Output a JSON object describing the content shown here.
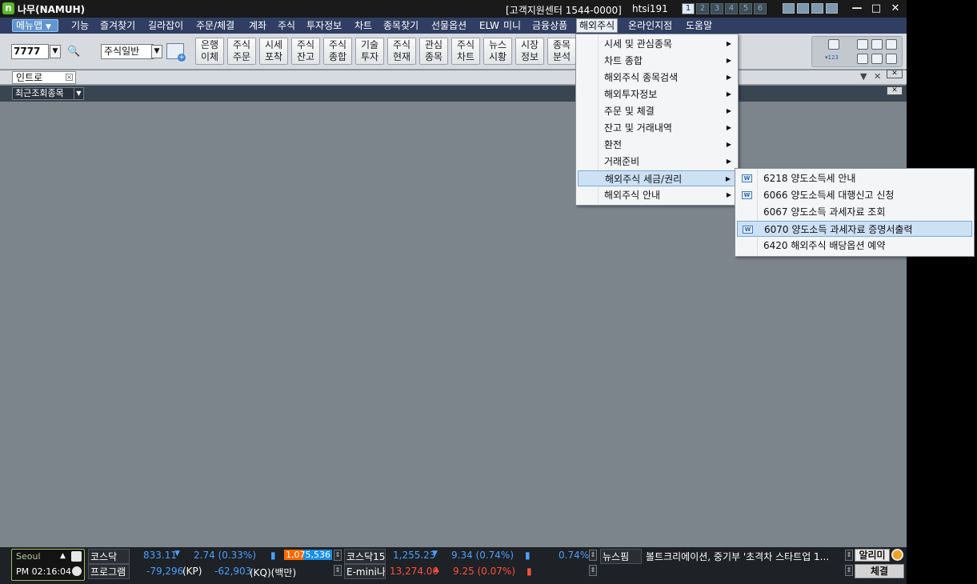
{
  "window": {
    "title": "나무(NAMUH)",
    "support": "[고객지원센터 1544-0000]",
    "user_id": "htsi191",
    "screen_tabs": [
      "1",
      "2",
      "3",
      "4",
      "5",
      "6"
    ]
  },
  "menubar": {
    "menumap_label": "메뉴맵",
    "items": [
      "기능",
      "즐겨찾기",
      "길라잡이",
      "주문/체결",
      "계좌",
      "주식",
      "투자정보",
      "차트",
      "종목찾기",
      "선물옵션",
      "ELW",
      "미니",
      "금융상품",
      "해외주식",
      "온라인지점",
      "도움말"
    ]
  },
  "toolbar": {
    "code_value": "7777",
    "type_select": "주식일반",
    "buttons": [
      "은행\n이체",
      "주식\n주문",
      "시세\n포착",
      "주식\n잔고",
      "주식\n종합",
      "기술\n투자",
      "주식\n현재",
      "관심\n종목",
      "주식\n차트",
      "뉴스\n시황",
      "시장\n정보",
      "종목\n분석"
    ],
    "rtools_sub_label": "▾123"
  },
  "tabbar": {
    "tab_label": "인트로"
  },
  "recentbar": {
    "recent_label": "최근조회종목"
  },
  "menu_overseas": {
    "items": [
      {
        "label": "시세 및 관심종목"
      },
      {
        "label": "차트 종합"
      },
      {
        "label": "해외주식 종목검색"
      },
      {
        "label": "해외투자정보"
      },
      {
        "label": "주문 및 체결"
      },
      {
        "label": "잔고 및 거래내역"
      },
      {
        "label": "환전"
      },
      {
        "label": "거래준비"
      },
      {
        "label": "해외주식 세금/권리"
      },
      {
        "label": "해외주식 안내"
      }
    ],
    "selected_index": 8
  },
  "submenu_tax": {
    "items": [
      {
        "label": "6218 양도소득세 안내",
        "icon": "window-icon",
        "has_icon": true
      },
      {
        "label": "6066 양도소득세 대행신고 신청",
        "icon": "window-icon",
        "has_icon": true
      },
      {
        "label": "6067 양도소득 과세자료 조회",
        "has_icon": false
      },
      {
        "label": "6070 양도소득 과세자료 증명서출력",
        "icon": "window-icon",
        "has_icon": true
      },
      {
        "label": "6420 해외주식 배당옵션 예약",
        "has_icon": false
      }
    ],
    "selected_index": 3
  },
  "status": {
    "city": "Seoul",
    "time": "PM 02:16:04",
    "row1": {
      "label": "코스닥",
      "value": "833.11",
      "change": "2.74 (0.33%)",
      "bar_value": "1,075,536",
      "label2": "코스닥15(",
      "value2": "1,255.23",
      "change2": "9.34 (0.74%)",
      "pct": "0.74%",
      "news_label": "뉴스핌",
      "news_text": "볼트크리에이션, 중기부 '초격차 스타트업 1..."
    },
    "row2": {
      "label": "프로그램",
      "kp": "-79,296",
      "kp_unit": "(KP)",
      "kq": "-62,903",
      "kq_unit": "(KQ)(백만)",
      "label2": "E-mini나",
      "value2": "13,274.00",
      "change2": "9.25 (0.07%)"
    },
    "alrimi": "알리미",
    "chegyeol": "체결"
  },
  "colors": {
    "menubar_bg": "#2f3e62",
    "workspace_bg": "#7d858c",
    "selection_bg": "#cde1f5",
    "down_blue": "#4aa0ff",
    "up_red": "#ff5040"
  }
}
